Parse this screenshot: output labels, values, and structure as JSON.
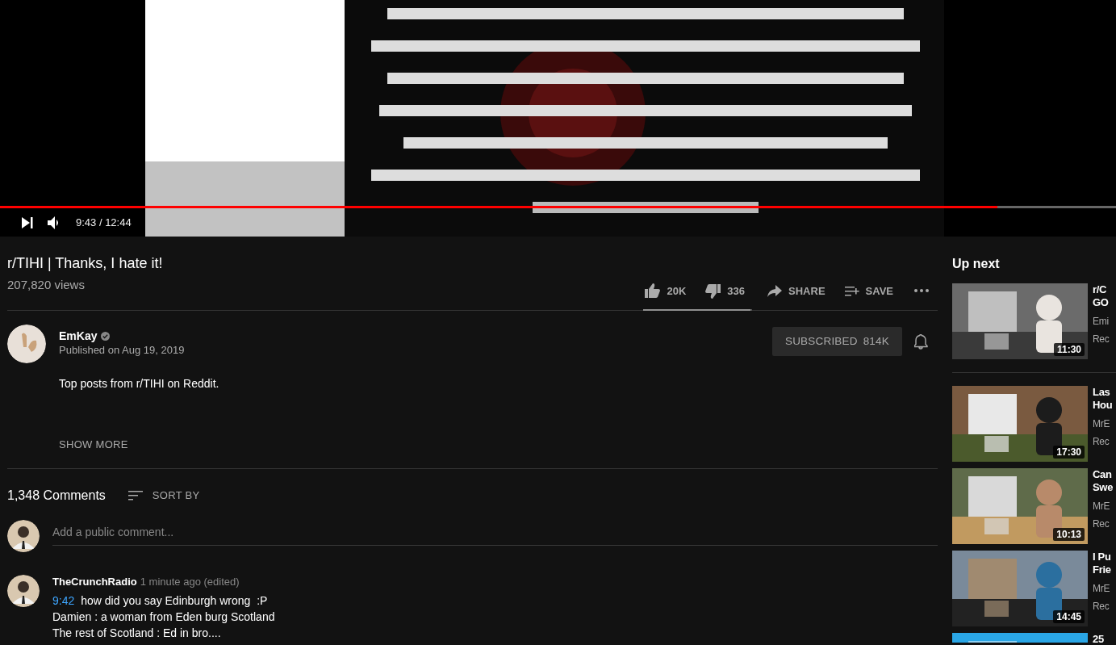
{
  "player": {
    "kind": "picture",
    "progress": {
      "level": 0.894
    },
    "time": "9:43 / 12:44"
  },
  "video": {
    "title": "r/TIHI | Thanks, I hate it!",
    "views": "207,820 views",
    "actions": [
      {
        "kind": "like",
        "label": "20K"
      },
      {
        "kind": "dislike",
        "label": "336"
      },
      {
        "kind": "share",
        "label": "SHARE"
      },
      {
        "kind": "save",
        "label": "SAVE"
      },
      {
        "kind": "more"
      }
    ],
    "sentiment": {
      "level": 0.98
    }
  },
  "channel": {
    "name": "EmKay",
    "verified": true,
    "published": "Published on Aug 19, 2019",
    "subscribe": {
      "label": "SUBSCRIBED",
      "count": "814K",
      "subscribed": true
    }
  },
  "description": "Top posts from r/TIHI on Reddit.",
  "show_more": "SHOW MORE",
  "comments": {
    "count": "1,348 Comments",
    "sort": "SORT BY",
    "placeholder": "Add a public comment...",
    "items": [
      {
        "author": "TheCrunchRadio",
        "time": "1 minute ago (edited)",
        "timestamp": "9:42",
        "lines": [
          "how did you say Edinburgh wrong  :P",
          "Damien : a woman from Eden burg Scotland",
          "The rest of Scotland : Ed in bro...."
        ]
      }
    ]
  },
  "up_next": {
    "heading": "Up next",
    "items": [
      {
        "duration": "11:30",
        "title_lines": [
          "r/C",
          "GO"
        ],
        "channel": "Emi",
        "meta": "Rec"
      },
      {
        "duration": "17:30",
        "title_lines": [
          "Las",
          "Hou"
        ],
        "channel": "MrE",
        "meta": "Rec"
      },
      {
        "duration": "10:13",
        "title_lines": [
          "Can",
          "Swe"
        ],
        "channel": "MrE",
        "meta": "Rec"
      },
      {
        "duration": "14:45",
        "title_lines": [
          "I Pu",
          "Frie"
        ],
        "channel": "MrE",
        "meta": "Rec"
      },
      {
        "title_lines": [
          "25"
        ]
      }
    ]
  }
}
